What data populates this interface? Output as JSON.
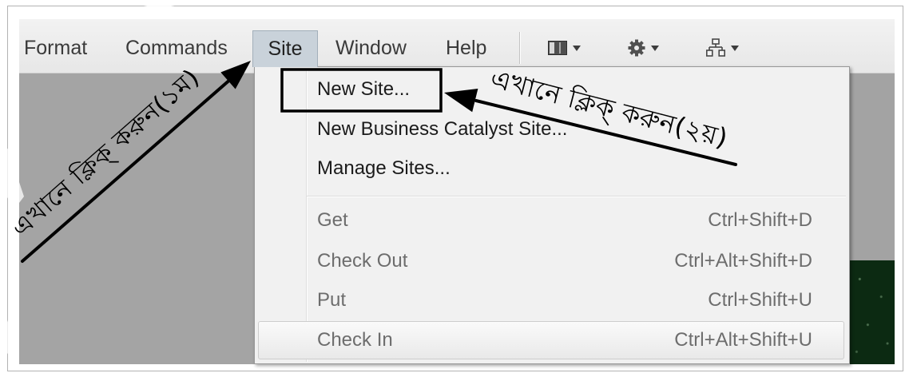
{
  "menubar": {
    "items": [
      {
        "label": "Format",
        "active": false
      },
      {
        "label": "Commands",
        "active": false
      },
      {
        "label": "Site",
        "active": true
      },
      {
        "label": "Window",
        "active": false
      },
      {
        "label": "Help",
        "active": false
      }
    ],
    "tools": [
      {
        "icon": "layout-icon",
        "dropdown_icon": "chevron-down-icon"
      },
      {
        "icon": "gear-icon",
        "dropdown_icon": "chevron-down-icon"
      },
      {
        "icon": "site-hierarchy-icon",
        "dropdown_icon": "chevron-down-icon"
      }
    ]
  },
  "site_menu": {
    "groups": [
      {
        "items": [
          {
            "label": "New Site...",
            "enabled": true,
            "hovered": false,
            "boxed": true
          },
          {
            "label": "New Business Catalyst Site...",
            "enabled": true,
            "hovered": false
          },
          {
            "label": "Manage Sites...",
            "enabled": true,
            "hovered": false
          }
        ]
      },
      {
        "items": [
          {
            "label": "Get",
            "shortcut": "Ctrl+Shift+D",
            "enabled": false,
            "hovered": false
          },
          {
            "label": "Check Out",
            "shortcut": "Ctrl+Alt+Shift+D",
            "enabled": false,
            "hovered": false
          },
          {
            "label": "Put",
            "shortcut": "Ctrl+Shift+U",
            "enabled": false,
            "hovered": false
          },
          {
            "label": "Check In",
            "shortcut": "Ctrl+Alt+Shift+U",
            "enabled": false,
            "hovered": true
          }
        ]
      }
    ]
  },
  "annotations": [
    {
      "text": "এখানে ক্লিক্ করুন(১ম)"
    },
    {
      "text": "এখানে ক্লিক্ করুন(২য়)"
    }
  ],
  "colors": {
    "menu_highlight": "#c9d2da",
    "annotation": "#000000",
    "disabled_text": "#6d6d6d",
    "workspace_gray": "#a4a4a4",
    "canvas_green": "#0c2a12"
  }
}
